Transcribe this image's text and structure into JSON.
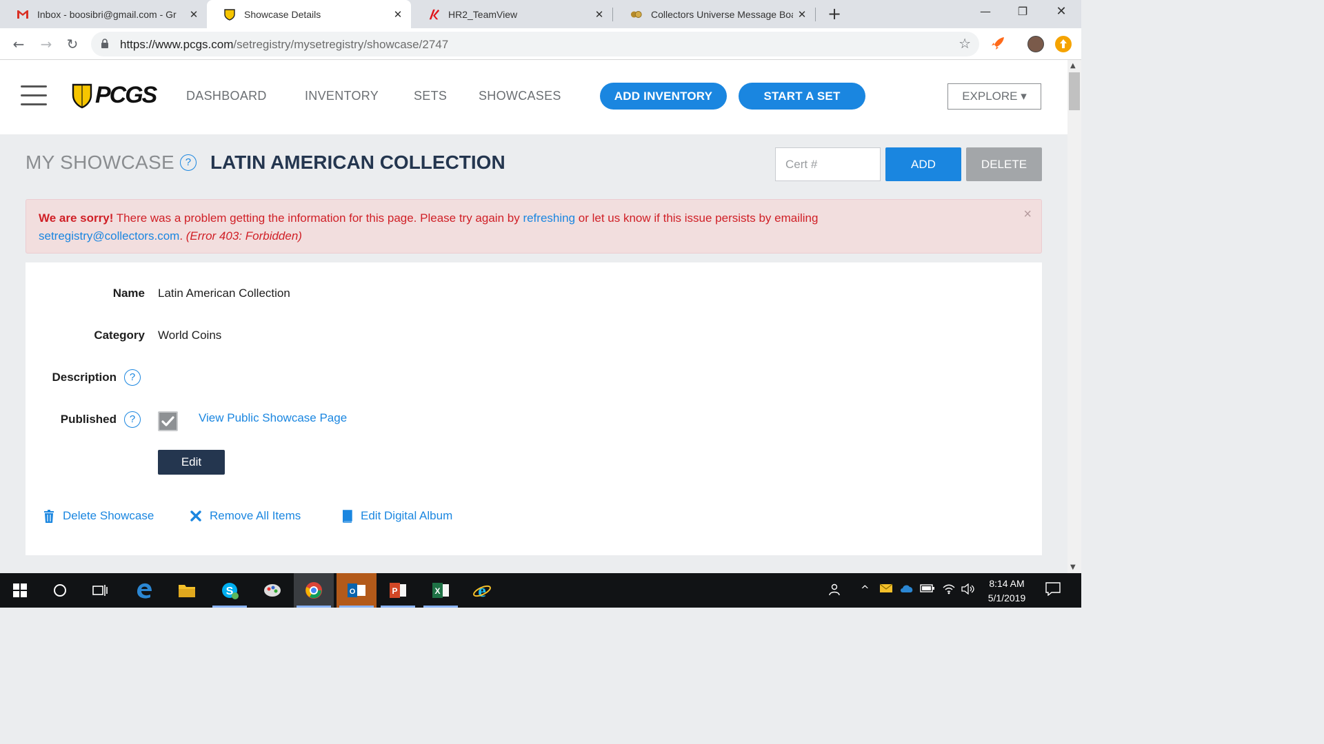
{
  "browser": {
    "tabs": [
      {
        "title": "Inbox - boosibri@gmail.com - Gr",
        "icon": "gmail-icon"
      },
      {
        "title": "Showcase Details",
        "icon": "pcgs-shield-icon"
      },
      {
        "title": "HR2_TeamView",
        "icon": "teamview-icon"
      },
      {
        "title": "Collectors Universe Message Boa",
        "icon": "coins-icon"
      }
    ],
    "url_host": "https://www.pcgs.com",
    "url_path": "/setregistry/mysetregistry/showcase/2747"
  },
  "header": {
    "logo_text": "PCGS",
    "nav": [
      "DASHBOARD",
      "INVENTORY",
      "SETS",
      "SHOWCASES"
    ],
    "add_inventory": "ADD INVENTORY",
    "start_set": "START A SET",
    "explore": "EXPLORE ▾"
  },
  "page": {
    "my_showcase": "MY SHOWCASE",
    "help": "?",
    "showcase_name": "LATIN AMERICAN COLLECTION",
    "cert_placeholder": "Cert #",
    "add": "ADD",
    "delete": "DELETE"
  },
  "alert": {
    "strong": "We are sorry!",
    "text1": " There was a problem getting the information for this page. Please try again by ",
    "link1": "refreshing",
    "text2": " or let us know if this issue persists by emailing ",
    "email": "setregistry@collectors.com",
    "text3": ". ",
    "error": "(Error 403: Forbidden)",
    "close": "×"
  },
  "details": {
    "name_label": "Name",
    "name_value": "Latin American Collection",
    "category_label": "Category",
    "category_value": "World Coins",
    "description_label": "Description",
    "published_label": "Published",
    "published": true,
    "view_public": "View Public Showcase Page",
    "edit": "Edit"
  },
  "actions": {
    "delete_showcase": "Delete Showcase",
    "remove_all": "Remove All Items",
    "edit_album": "Edit Digital Album"
  },
  "taskbar": {
    "time": "8:14 AM",
    "date": "5/1/2019"
  },
  "colors": {
    "accent": "#1a86e0",
    "navy": "#24364f",
    "alert_text": "#d01f26",
    "alert_bg": "#f2dede"
  }
}
